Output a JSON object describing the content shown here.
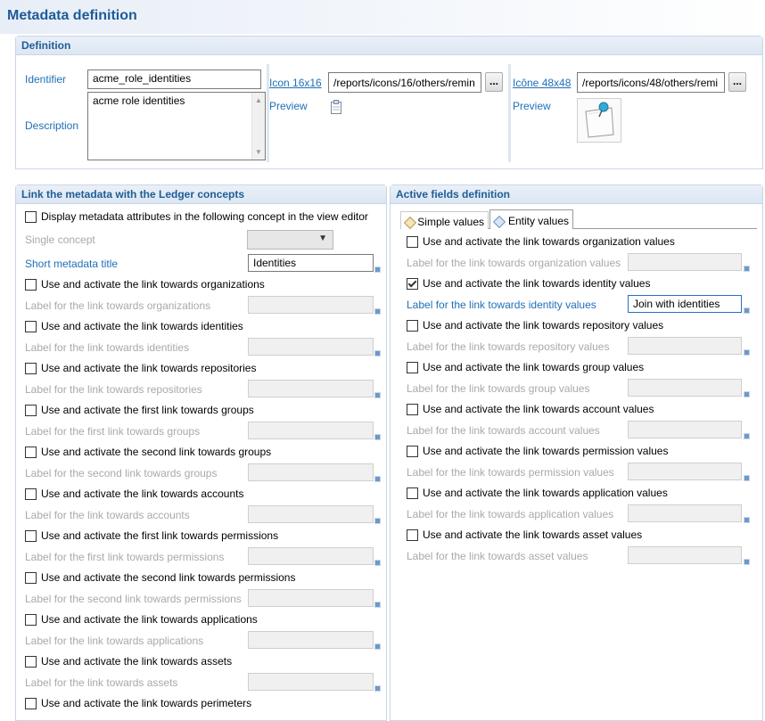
{
  "page_title": "Metadata definition",
  "definition": {
    "header": "Definition",
    "identifier_label": "Identifier",
    "identifier_value": "acme_role_identities",
    "description_label": "Description",
    "description_value": "acme role identities",
    "icon16_label": "Icon 16x16",
    "icon16_value": "/reports/icons/16/others/remin",
    "icon48_label": "Icône 48x48",
    "icon48_value": "/reports/icons/48/others/remi",
    "browse_label": "...",
    "preview_label": "Preview",
    "preview16_icon": "note-icon",
    "preview48_icon": "sticky-note-pin-icon"
  },
  "ledger": {
    "header": "Link the metadata with the Ledger concepts",
    "display_attrs_label": "Display metadata attributes in the following concept in the view editor",
    "single_concept_label": "Single concept",
    "short_title_label": "Short metadata title",
    "short_title_value": "Identities",
    "rows": [
      {
        "check": "Use and activate the link towards organizations",
        "label": "Label for the link towards organizations"
      },
      {
        "check": "Use and activate the link towards identities",
        "label": "Label for the link towards identities"
      },
      {
        "check": "Use and activate the link towards repositories",
        "label": "Label for the link towards repositories"
      },
      {
        "check": "Use and activate the first link towards groups",
        "label": "Label for the first link towards groups"
      },
      {
        "check": "Use and activate the second link towards groups",
        "label": "Label for the second link towards groups"
      },
      {
        "check": "Use and activate the link towards accounts",
        "label": "Label for the link towards accounts"
      },
      {
        "check": "Use and activate the first link towards permissions",
        "label": "Label for the first link towards permissions"
      },
      {
        "check": "Use and activate the second link towards permissions",
        "label": "Label for the second link towards permissions"
      },
      {
        "check": "Use and activate the link towards applications",
        "label": "Label for the link towards applications"
      },
      {
        "check": "Use and activate the link towards assets",
        "label": "Label for the link towards assets"
      },
      {
        "check": "Use and activate the link towards perimeters",
        "label": ""
      }
    ]
  },
  "active": {
    "header": "Active fields definition",
    "tabs": [
      {
        "label": "Simple values",
        "icon": "tag-icon"
      },
      {
        "label": "Entity values",
        "icon": "tag-icon"
      }
    ],
    "selected_tab": "Entity values",
    "rows": [
      {
        "check": "Use and activate the link towards organization values",
        "label": "Label for the link towards organization values",
        "checked": false,
        "value": ""
      },
      {
        "check": "Use and activate the link towards identity values",
        "label": "Label for the link towards identity values",
        "checked": true,
        "value": "Join with identities"
      },
      {
        "check": "Use and activate the link towards repository values",
        "label": "Label for the link towards repository values",
        "checked": false,
        "value": ""
      },
      {
        "check": "Use and activate the link towards group values",
        "label": "Label for the link towards group values",
        "checked": false,
        "value": ""
      },
      {
        "check": "Use and activate the link towards account values",
        "label": "Label for the link towards account values",
        "checked": false,
        "value": ""
      },
      {
        "check": "Use and activate the link towards permission values",
        "label": "Label for the link towards permission values",
        "checked": false,
        "value": ""
      },
      {
        "check": "Use and activate the link towards application values",
        "label": "Label for the link towards application values",
        "checked": false,
        "value": ""
      },
      {
        "check": "Use and activate the link towards asset values",
        "label": "Label for the link towards asset values",
        "checked": false,
        "value": ""
      }
    ]
  }
}
